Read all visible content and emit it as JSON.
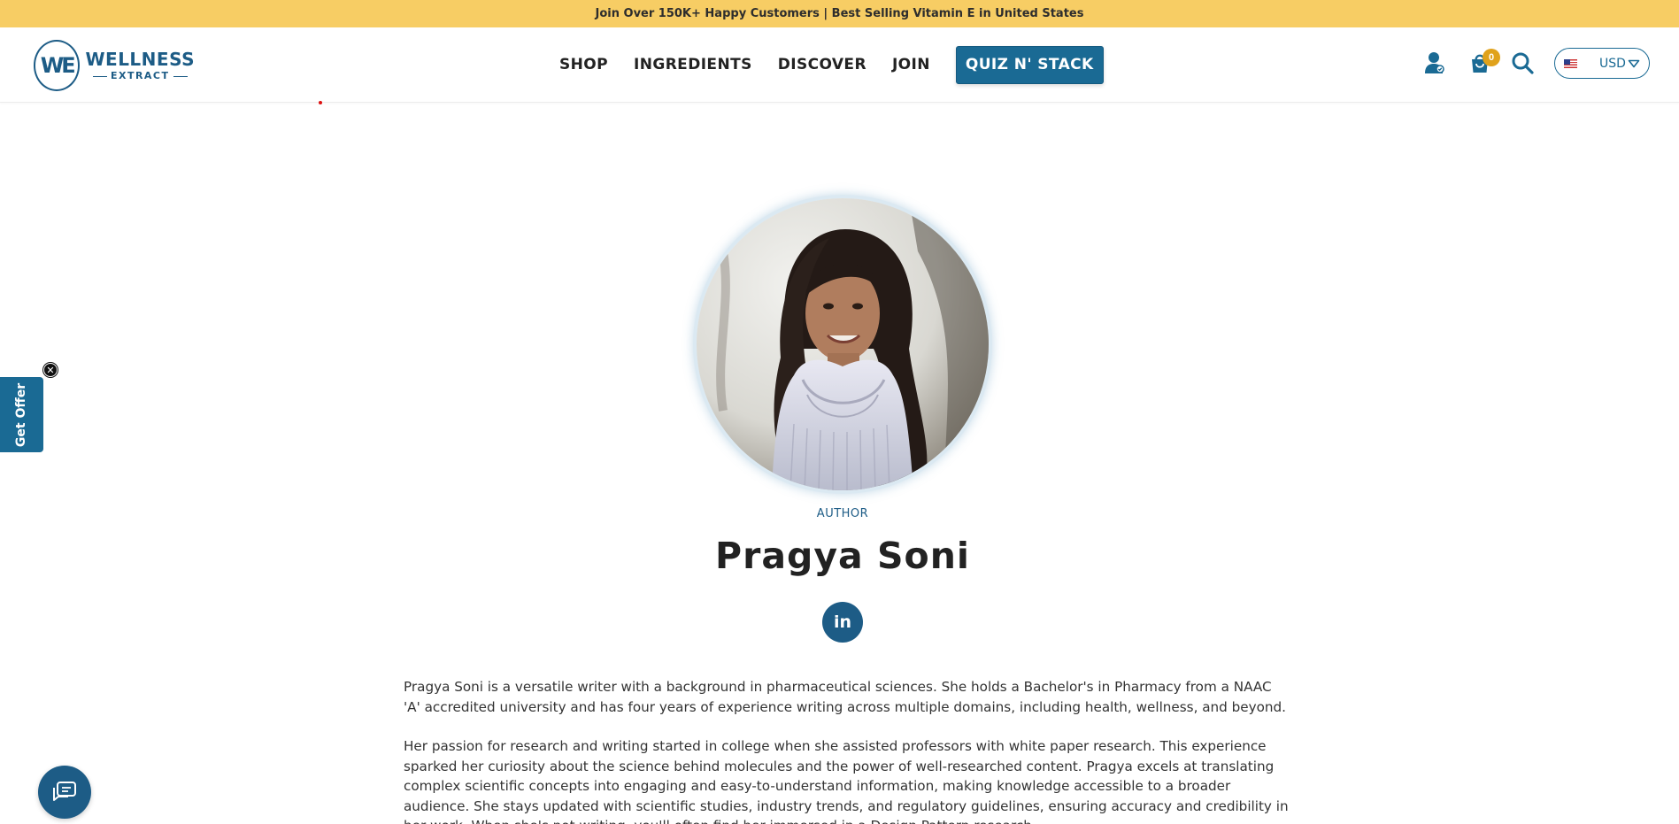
{
  "announcement": "Join Over 150K+ Happy Customers | Best Selling Vitamin E in United States",
  "logo": {
    "line1": "WELLNESS",
    "line2": "EXTRACT",
    "mark": "WE"
  },
  "nav": {
    "items": [
      "SHOP",
      "INGREDIENTS",
      "DISCOVER",
      "JOIN"
    ],
    "cta": "QUIZ N' STACK"
  },
  "utilities": {
    "user_icon": "user-icon",
    "cart_icon": "cart-icon",
    "cart_count": "0",
    "search_icon": "search-icon",
    "currency": "USD"
  },
  "author": {
    "role": "AUTHOR",
    "name": "Pragya Soni",
    "social": "in",
    "bio": [
      "Pragya Soni is a versatile writer with a background in pharmaceutical sciences. She holds a Bachelor's in Pharmacy from a NAAC 'A' accredited university and has four years of experience writing across multiple domains, including health, wellness, and beyond.",
      "Her passion for research and writing started in college when she assisted professors with white paper research. This experience sparked her curiosity about the science behind molecules and the power of well-researched content. Pragya excels at translating complex scientific concepts into engaging and easy-to-understand information, making knowledge accessible to a broader audience. She stays updated with scientific studies, industry trends, and regulatory guidelines, ensuring accuracy and credibility in her work. When she's not writing, you'll often find her immersed in a Design Pattern research."
    ]
  },
  "offer_tab": "Get Offer",
  "colors": {
    "brand": "#1d5c86",
    "accent": "#f7cd64",
    "badge": "#e0a21b"
  }
}
